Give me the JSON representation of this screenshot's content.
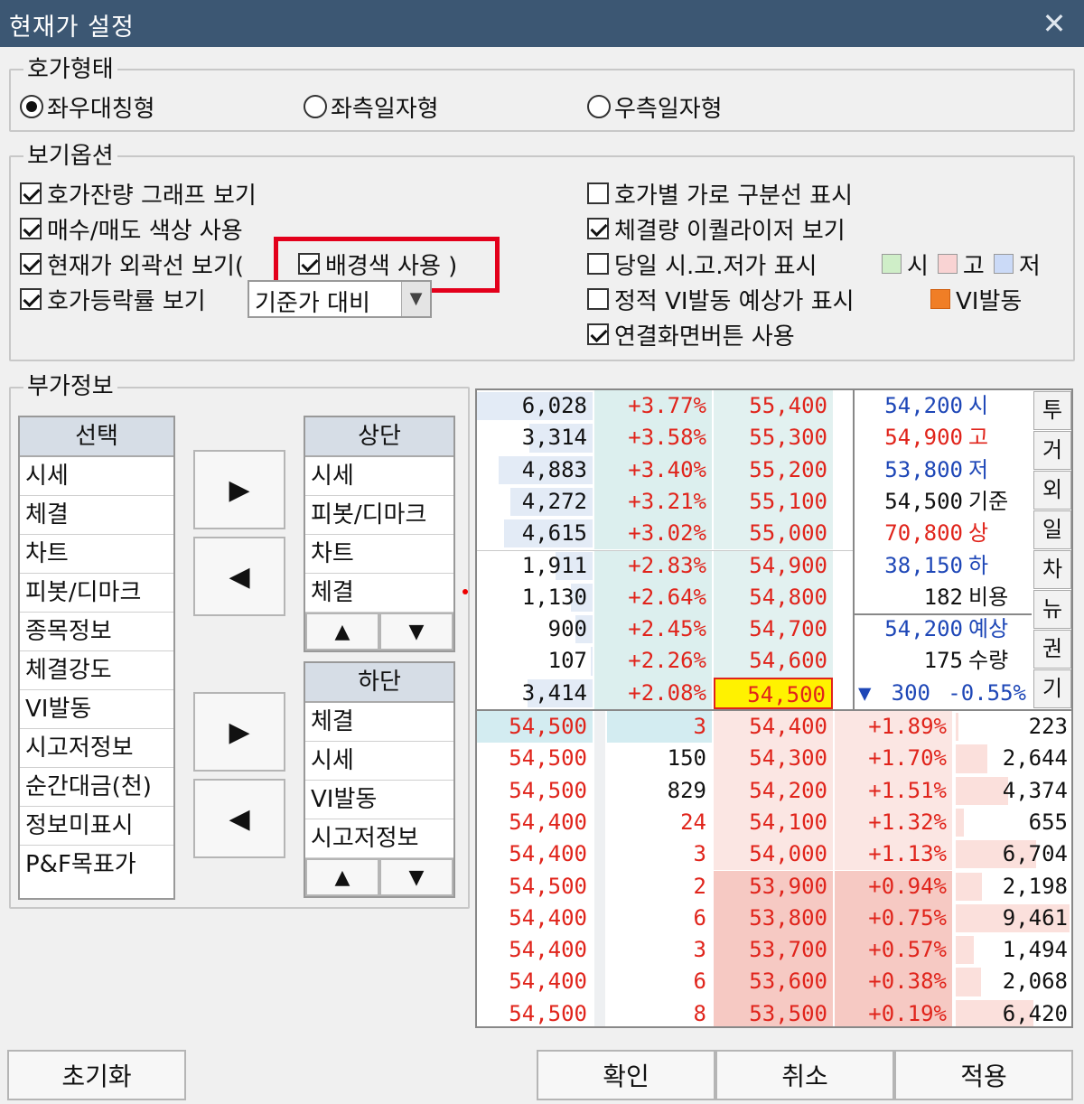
{
  "window": {
    "title": "현재가 설정"
  },
  "hoga_type": {
    "legend": "호가형태",
    "options": [
      {
        "label": "좌우대칭형",
        "selected": true
      },
      {
        "label": "좌측일자형",
        "selected": false
      },
      {
        "label": "우측일자형",
        "selected": false
      }
    ]
  },
  "view_options": {
    "legend": "보기옵션",
    "left": [
      {
        "label": "호가잔량 그래프 보기",
        "checked": true
      },
      {
        "label": "매수/매도 색상 사용",
        "checked": true
      },
      {
        "label": "현재가 외곽선 보기(",
        "checked": true
      },
      {
        "label": "호가등락률 보기",
        "checked": true
      }
    ],
    "background_color": {
      "label": "배경색 사용 )",
      "checked": true
    },
    "dropdown_value": "기준가 대비",
    "right": [
      {
        "label": "호가별 가로 구분선 표시",
        "checked": false
      },
      {
        "label": "체결량 이퀄라이저 보기",
        "checked": true
      },
      {
        "label": "당일 시.고.저가 표시",
        "checked": false
      },
      {
        "label": "정적 VI발동 예상가 표시",
        "checked": false
      },
      {
        "label": "연결화면버튼 사용",
        "checked": true
      }
    ],
    "legend_swatches": [
      {
        "label": "시",
        "color": "#cfeec8"
      },
      {
        "label": "고",
        "color": "#f9d3d3"
      },
      {
        "label": "저",
        "color": "#cbdaf7"
      }
    ],
    "vi_swatch": {
      "label": "VI발동",
      "color": "#f07e26"
    }
  },
  "extra_info": {
    "legend": "부가정보",
    "select_list": {
      "header": "선택",
      "items": [
        "시세",
        "체결",
        "차트",
        "피봇/디마크",
        "종목정보",
        "체결강도",
        "VI발동",
        "시고저정보",
        "순간대금(천)",
        "정보미표시",
        "P&F목표가"
      ]
    },
    "top_list": {
      "header": "상단",
      "items": [
        "시세",
        "피봇/디마크",
        "차트",
        "체결"
      ]
    },
    "bottom_list": {
      "header": "하단",
      "items": [
        "체결",
        "시세",
        "VI발동",
        "시고저정보"
      ]
    },
    "arrows": {
      "right": "▶",
      "left": "◀",
      "up": "▲",
      "down": "▼"
    }
  },
  "preview": {
    "ask_rows": [
      {
        "qty": "6,028",
        "pct": "+3.77%",
        "price": "55,400"
      },
      {
        "qty": "3,314",
        "pct": "+3.58%",
        "price": "55,300"
      },
      {
        "qty": "4,883",
        "pct": "+3.40%",
        "price": "55,200"
      },
      {
        "qty": "4,272",
        "pct": "+3.21%",
        "price": "55,100"
      },
      {
        "qty": "4,615",
        "pct": "+3.02%",
        "price": "55,000"
      },
      {
        "qty": "1,911",
        "pct": "+2.83%",
        "price": "54,900"
      },
      {
        "qty": "1,130",
        "pct": "+2.64%",
        "price": "54,800"
      },
      {
        "qty": "900",
        "pct": "+2.45%",
        "price": "54,700"
      },
      {
        "qty": "107",
        "pct": "+2.26%",
        "price": "54,600"
      },
      {
        "qty": "3,414",
        "pct": "+2.08%",
        "price": "54,500"
      }
    ],
    "info_rows": [
      {
        "value": "54,200",
        "label": "시",
        "color": "blue"
      },
      {
        "value": "54,900",
        "label": "고",
        "color": "red"
      },
      {
        "value": "53,800",
        "label": "저",
        "color": "blue"
      },
      {
        "value": "54,500",
        "label": "기준",
        "color": "black"
      },
      {
        "value": "70,800",
        "label": "상",
        "color": "red"
      },
      {
        "value": "38,150",
        "label": "하",
        "color": "blue"
      },
      {
        "value": "182",
        "label": "비용",
        "color": "black"
      },
      {
        "value": "54,200",
        "label": "예상",
        "color": "blue"
      },
      {
        "value": "175",
        "label": "수량",
        "color": "black"
      }
    ],
    "change": {
      "arrow": "▼",
      "amount": "300",
      "pct": "-0.55%"
    },
    "side_tabs": [
      "투",
      "거",
      "외",
      "일",
      "차",
      "뉴",
      "권",
      "기"
    ],
    "bid_rows": [
      {
        "trade_price": "54,500",
        "trade_qty": "3",
        "price": "54,400",
        "pct": "+1.89%",
        "qty": "223"
      },
      {
        "trade_price": "54,500",
        "trade_qty": "150",
        "price": "54,300",
        "pct": "+1.70%",
        "qty": "2,644"
      },
      {
        "trade_price": "54,500",
        "trade_qty": "829",
        "price": "54,200",
        "pct": "+1.51%",
        "qty": "4,374"
      },
      {
        "trade_price": "54,400",
        "trade_qty": "24",
        "price": "54,100",
        "pct": "+1.32%",
        "qty": "655"
      },
      {
        "trade_price": "54,400",
        "trade_qty": "3",
        "price": "54,000",
        "pct": "+1.13%",
        "qty": "6,704"
      },
      {
        "trade_price": "54,500",
        "trade_qty": "2",
        "price": "53,900",
        "pct": "+0.94%",
        "qty": "2,198"
      },
      {
        "trade_price": "54,400",
        "trade_qty": "6",
        "price": "53,800",
        "pct": "+0.75%",
        "qty": "9,461"
      },
      {
        "trade_price": "54,400",
        "trade_qty": "3",
        "price": "53,700",
        "pct": "+0.57%",
        "qty": "1,494"
      },
      {
        "trade_price": "54,400",
        "trade_qty": "6",
        "price": "53,600",
        "pct": "+0.38%",
        "qty": "2,068"
      },
      {
        "trade_price": "54,500",
        "trade_qty": "8",
        "price": "53,500",
        "pct": "+0.19%",
        "qty": "6,420"
      }
    ]
  },
  "footer": {
    "reset": "초기화",
    "ok": "확인",
    "cancel": "취소",
    "apply": "적용"
  }
}
